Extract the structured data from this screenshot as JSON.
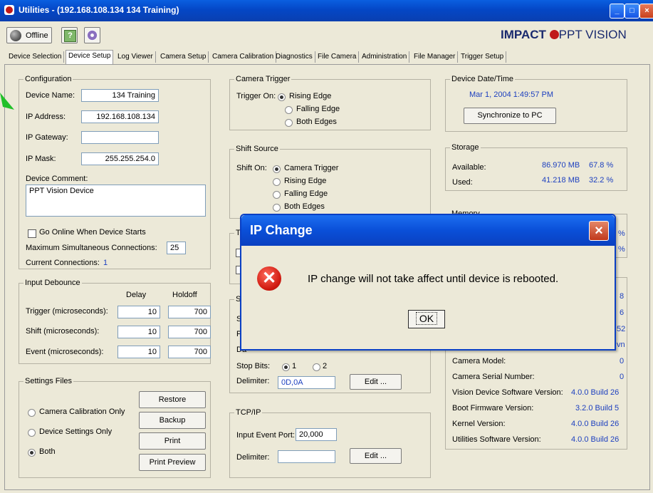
{
  "window": {
    "title": "Utilities - (192.168.108.134   134 Training)",
    "minimize": "_",
    "maximize": "□",
    "close": "×"
  },
  "toolbar": {
    "offline_label": "Offline",
    "brand_left": "IMPACT",
    "brand_right": "PPT VISION"
  },
  "tabs": [
    {
      "label": "Device Selection"
    },
    {
      "label": "Device Setup"
    },
    {
      "label": "Log Viewer"
    },
    {
      "label": "Camera Setup"
    },
    {
      "label": "Camera Calibration"
    },
    {
      "label": "Diagnostics"
    },
    {
      "label": "File Camera"
    },
    {
      "label": "Administration"
    },
    {
      "label": "File Manager"
    },
    {
      "label": "Trigger Setup"
    }
  ],
  "configuration": {
    "title": "Configuration",
    "device_name_label": "Device Name:",
    "device_name_value": "134 Training",
    "ip_address_label": "IP Address:",
    "ip_address_value": "192.168.108.134",
    "ip_gateway_label": "IP Gateway:",
    "ip_gateway_value": "",
    "ip_mask_label": "IP Mask:",
    "ip_mask_value": "255.255.254.0",
    "device_comment_label": "Device Comment:",
    "device_comment_value": "PPT Vision Device",
    "go_online_label": "Go Online When Device Starts",
    "max_connections_label": "Maximum Simultaneous Connections:",
    "max_connections_value": "25",
    "current_connections_label": "Current Connections:",
    "current_connections_value": "1"
  },
  "input_debounce": {
    "title": "Input Debounce",
    "delay_header": "Delay",
    "holdoff_header": "Holdoff",
    "rows": [
      {
        "label": "Trigger (microseconds):",
        "delay": "10",
        "holdoff": "700"
      },
      {
        "label": "Shift (microseconds):",
        "delay": "10",
        "holdoff": "700"
      },
      {
        "label": "Event (microseconds):",
        "delay": "10",
        "holdoff": "700"
      }
    ]
  },
  "settings_files": {
    "title": "Settings Files",
    "options": [
      "Camera Calibration Only",
      "Device Settings Only",
      "Both"
    ],
    "buttons": [
      "Restore",
      "Backup",
      "Print",
      "Print Preview"
    ]
  },
  "camera_trigger": {
    "title": "Camera Trigger",
    "label": "Trigger On:",
    "options": [
      "Rising Edge",
      "Falling Edge",
      "Both Edges"
    ]
  },
  "shift_source": {
    "title": "Shift Source",
    "label": "Shift On:",
    "options": [
      "Camera Trigger",
      "Rising Edge",
      "Falling Edge",
      "Both Edges"
    ]
  },
  "timing_partial": {
    "title": "Ti"
  },
  "serial_partial": {
    "title": "Se",
    "row1": "Sp",
    "row2": "Pa",
    "row3": "Da",
    "stop_bits_label": "Stop Bits:",
    "stop_bits_options": [
      "1",
      "2"
    ],
    "delimiter_label": "Delimiter:",
    "delimiter_value": "0D,0A",
    "edit_label": "Edit ..."
  },
  "tcpip": {
    "title": "TCP/IP",
    "input_event_port_label": "Input Event Port:",
    "input_event_port_value": "20,000",
    "delimiter_label": "Delimiter:",
    "delimiter_value": "",
    "edit_label": "Edit ..."
  },
  "device_datetime": {
    "title": "Device Date/Time",
    "value": "Mar 1, 2004 1:49:57 PM",
    "sync_label": "Synchronize to PC"
  },
  "storage": {
    "title": "Storage",
    "rows": [
      {
        "label": "Available:",
        "size": "86.970 MB",
        "pct": "67.8 %"
      },
      {
        "label": "Used:",
        "size": "41.218 MB",
        "pct": "32.2 %"
      }
    ]
  },
  "memory_partial": {
    "title": "Memory",
    "pct1": "%",
    "pct2": "%"
  },
  "version_info": {
    "partial_values": [
      "8",
      "6",
      "52",
      "vn"
    ],
    "rows": [
      {
        "label": "Camera Model:",
        "value": "0"
      },
      {
        "label": "Camera Serial Number:",
        "value": "0"
      },
      {
        "label": "Vision Device Software Version:",
        "value": "4.0.0 Build 26"
      },
      {
        "label": "Boot Firmware Version:",
        "value": "3.2.0 Build 5"
      },
      {
        "label": "Kernel Version:",
        "value": "4.0.0 Build 26"
      },
      {
        "label": "Utilities Software Version:",
        "value": "4.0.0 Build 26"
      }
    ]
  },
  "dialog": {
    "title": "IP Change",
    "message": "IP change will not take affect until device is rebooted.",
    "ok_label": "OK",
    "close": "×",
    "error_glyph": "✕"
  },
  "colors": {
    "title_bar": "#0447c6",
    "value_blue": "#1c3fbf",
    "panel_bg": "#ece9d8",
    "arrow_green": "#22c02a"
  }
}
